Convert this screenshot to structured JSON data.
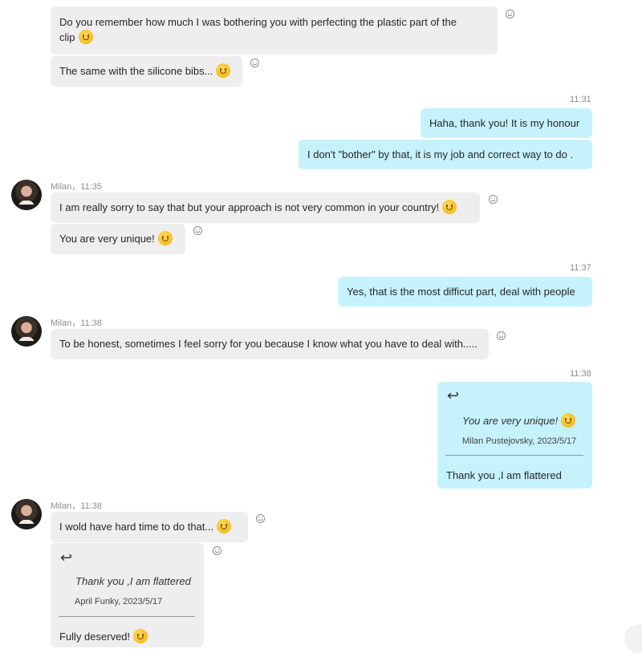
{
  "messages": {
    "m1": "Do you remember how much I was bothering you with perfecting the plastic part of the",
    "m1b": "clip",
    "m2": "The same with the silicone bibs...",
    "t1": "11:31",
    "m3": "Haha, thank you! It is my honour",
    "m4": "I don't \"bother\" by that, it is my job and correct way to do .",
    "s1": "Milan，11:35",
    "m5": "I am really sorry to say that but your approach is not very common in your country!",
    "m6": "You are very unique!",
    "t2": "11:37",
    "m7": "Yes, that is the most  difficut part, deal with people",
    "s2": "Milan，11:38",
    "m8": "To be honest, sometimes I feel sorry for you because I know what you have to deal with.....",
    "t3": "11:38",
    "q1_text": "You are very unique!",
    "q1_meta": "Milan Pustejovsky, 2023/5/17",
    "m9": "Thank you ,I am flattered",
    "s3": "Milan，11:38",
    "m10": "I wold have hard time to do that...",
    "q2_text": "Thank you ,I am flattered",
    "q2_meta": "April Funky, 2023/5/17",
    "m11": "Fully deserved!"
  },
  "icons": {
    "emoji": "smiling-face-emoji",
    "reaction": "add-reaction-icon",
    "reply": "reply-arrow-icon"
  },
  "colors": {
    "incoming_bubble": "#eeeeee",
    "outgoing_bubble": "#c6f2fc",
    "timestamp": "#8c8c8c"
  }
}
